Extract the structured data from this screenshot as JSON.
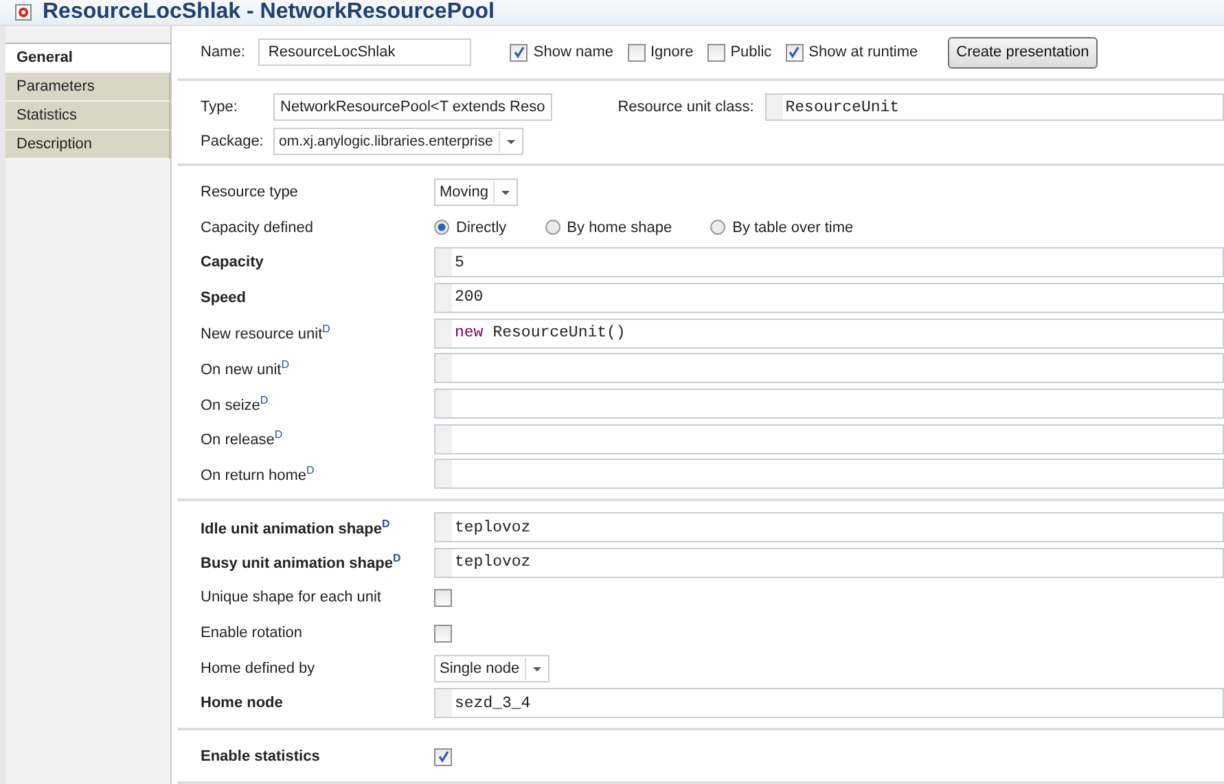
{
  "window": {
    "title": "ResourceLocShlak - NetworkResourcePool"
  },
  "tabs": [
    {
      "label": "General",
      "selected": true
    },
    {
      "label": "Parameters",
      "selected": false
    },
    {
      "label": "Statistics",
      "selected": false
    },
    {
      "label": "Description",
      "selected": false
    }
  ],
  "header": {
    "name_label": "Name:",
    "name_value": "ResourceLocShlak",
    "options": [
      {
        "label": "Show name",
        "checked": true
      },
      {
        "label": "Ignore",
        "checked": false
      },
      {
        "label": "Public",
        "checked": false
      },
      {
        "label": "Show at runtime",
        "checked": true
      }
    ],
    "button": "Create presentation"
  },
  "type_section": {
    "type_label": "Type:",
    "type_value": "NetworkResourcePool<T extends Reso",
    "unit_class_label": "Resource unit class:",
    "unit_class_value": "ResourceUnit",
    "package_label": "Package:",
    "package_value": "om.xj.anylogic.libraries.enterprise"
  },
  "sections": [
    {
      "rows": [
        {
          "kind": "dropdown",
          "label": "Resource type",
          "bold": false,
          "value": "Moving"
        },
        {
          "kind": "radio",
          "label": "Capacity defined",
          "bold": false,
          "options": [
            {
              "label": "Directly",
              "selected": true
            },
            {
              "label": "By home shape",
              "selected": false
            },
            {
              "label": "By table over time",
              "selected": false
            }
          ]
        },
        {
          "kind": "field",
          "label": "Capacity",
          "bold": true,
          "tokens": [
            {
              "text": "5",
              "kind": "plain"
            }
          ]
        },
        {
          "kind": "field",
          "label": "Speed",
          "bold": true,
          "tokens": [
            {
              "text": "200",
              "kind": "plain"
            }
          ]
        },
        {
          "kind": "field",
          "label": "New resource unit$^{D}$",
          "bold": false,
          "tokens": [
            {
              "text": "new",
              "kind": "keyword"
            },
            {
              "text": "ResourceUnit()",
              "kind": "plain"
            }
          ]
        },
        {
          "kind": "field",
          "label": "On new unit$^{D}$",
          "bold": false,
          "tokens": []
        },
        {
          "kind": "field",
          "label": "On seize$^{D}$",
          "bold": false,
          "tokens": []
        },
        {
          "kind": "field",
          "label": "On release$^{D}$",
          "bold": false,
          "tokens": []
        },
        {
          "kind": "field",
          "label": "On return home$^{D}$",
          "bold": false,
          "tokens": []
        }
      ]
    },
    {
      "rows": [
        {
          "kind": "field",
          "label": "Idle unit animation shape$^{D}$",
          "bold": true,
          "tokens": [
            {
              "text": "teplovoz",
              "kind": "plain"
            }
          ]
        },
        {
          "kind": "field",
          "label": "Busy unit animation shape$^{D}$",
          "bold": true,
          "tokens": [
            {
              "text": "teplovoz",
              "kind": "plain"
            }
          ]
        },
        {
          "kind": "checkbox",
          "label": "Unique shape for each unit",
          "bold": false,
          "checked": false
        },
        {
          "kind": "checkbox",
          "label": "Enable rotation",
          "bold": false,
          "checked": false
        },
        {
          "kind": "dropdown",
          "label": "Home defined by",
          "bold": false,
          "value": "Single node"
        },
        {
          "kind": "field",
          "label": "Home node",
          "bold": true,
          "tokens": [
            {
              "text": "sezd_3_4",
              "kind": "plain"
            }
          ]
        }
      ]
    },
    {
      "rows": [
        {
          "kind": "checkbox",
          "label": "Enable statistics",
          "bold": true,
          "checked": true
        }
      ]
    }
  ]
}
